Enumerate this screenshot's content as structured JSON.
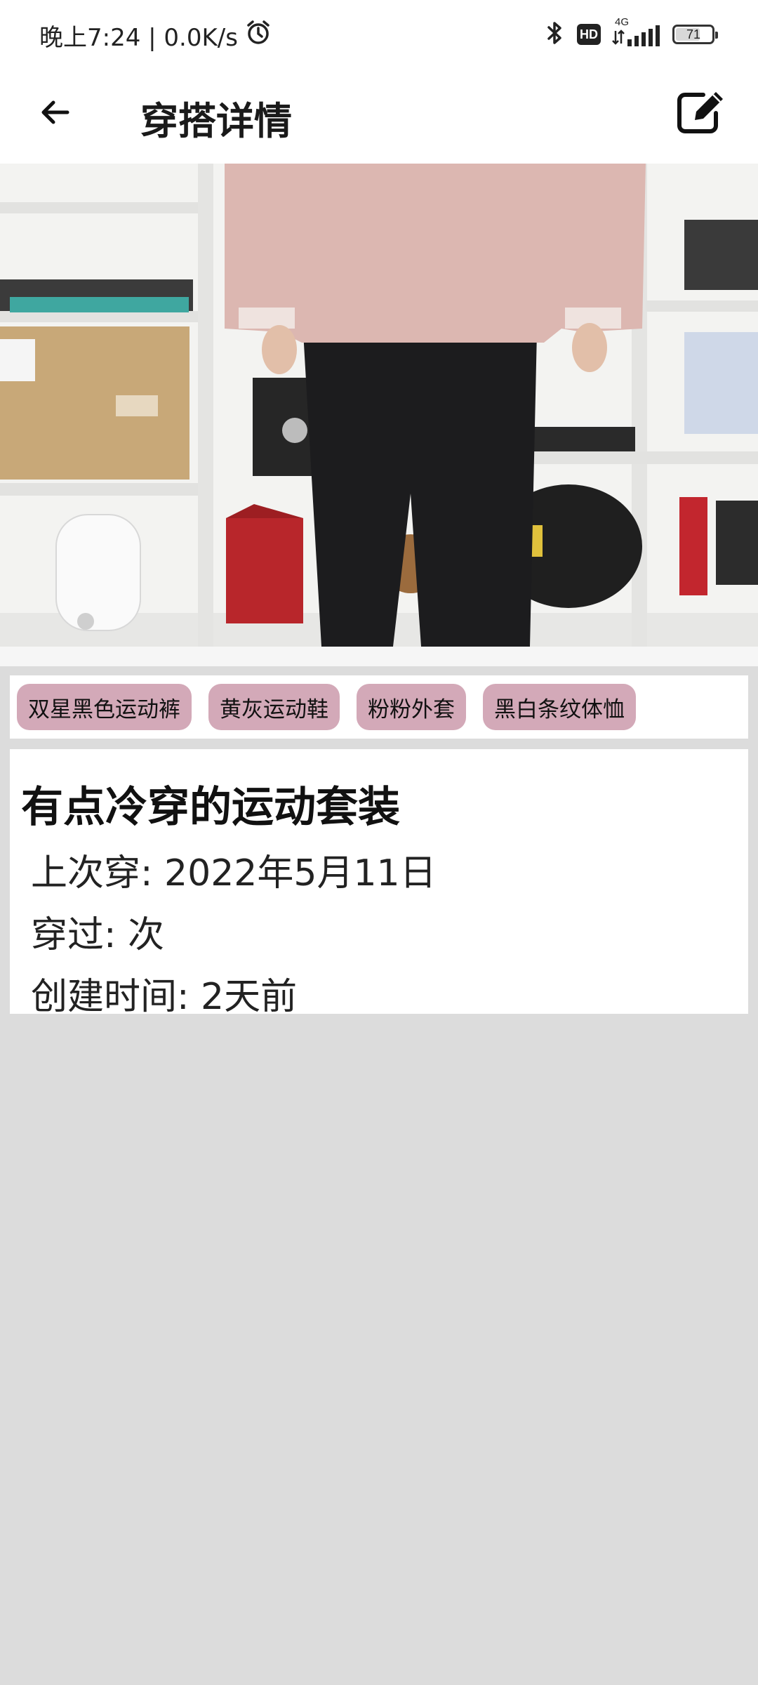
{
  "status_bar": {
    "time_text": "晚上7:24 | 0.0K/s",
    "network_type": "4G",
    "hd_label": "HD",
    "battery_level": "71",
    "icons": [
      "alarm-icon",
      "bluetooth-icon",
      "hd-icon",
      "signal-icon",
      "battery-icon"
    ]
  },
  "app_bar": {
    "title": "穿搭详情",
    "back_icon": "arrow-left-icon",
    "edit_icon": "edit-icon"
  },
  "tags": [
    {
      "label": "双星黑色运动裤"
    },
    {
      "label": "黄灰运动鞋"
    },
    {
      "label": "粉粉外套"
    },
    {
      "label": "黑白条纹体恤"
    }
  ],
  "outfit": {
    "title": "有点冷穿的运动套装",
    "last_worn": "上次穿: 2022年5月11日",
    "worn_count": "穿过: 次",
    "created": "创建时间: 2天前"
  },
  "colors": {
    "background": "#dcdcdc",
    "tag_chip": "#d3a9b8",
    "card": "#ffffff"
  }
}
